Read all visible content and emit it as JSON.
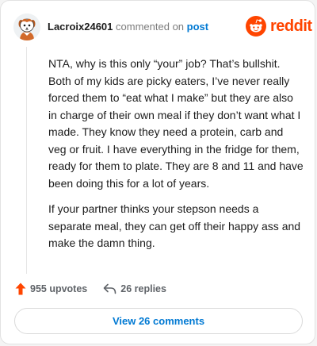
{
  "comment": {
    "username": "Lacroix24601",
    "commented_on": "commented on",
    "post_link": "post",
    "paragraphs": [
      "NTA, why is this only “your” job? That’s bullshit. Both of my kids are picky eaters, I’ve never really forced them to “eat what I make” but they are also in charge of their own meal if they don’t want what I made. They know they need a protein, carb and veg or fruit. I have everything in the fridge for them, ready for them to plate. They are 8 and 11 and have been doing this for a lot of years.",
      "If your partner thinks your stepson needs a separate meal, they can get off their happy ass and make the damn thing."
    ]
  },
  "brand": {
    "logo_text": "reddit",
    "color": "#ff4500"
  },
  "stats": {
    "upvotes": "955 upvotes",
    "replies": "26 replies"
  },
  "view_button": {
    "label": "View 26 comments"
  },
  "icons": {
    "avatar": "avatar-icon",
    "reddit_logo": "reddit-logo-icon",
    "upvote": "upvote-arrow-icon",
    "reply": "reply-arrow-icon"
  },
  "colors": {
    "accent": "#ff4500",
    "link": "#0079d3",
    "muted": "#7c7c7c"
  }
}
